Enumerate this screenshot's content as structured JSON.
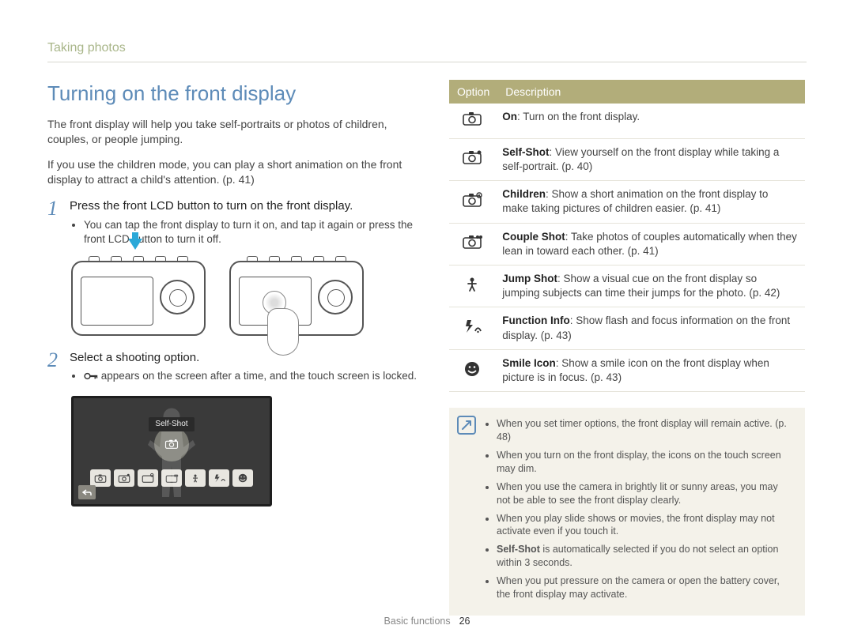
{
  "breadcrumb": "Taking photos",
  "title": "Turning on the front display",
  "intro1": "The front display will help you take self-portraits or photos of children, couples, or people jumping.",
  "intro2": "If you use the children mode, you can play a short animation on the front display to attract a child's attention. (p. 41)",
  "steps": [
    {
      "num": "1",
      "head": "Press the front LCD button to turn on the front display.",
      "bullets": [
        "You can tap the front display to turn it on, and tap it again or press the front LCD button to turn it off."
      ]
    },
    {
      "num": "2",
      "head": "Select a shooting option.",
      "bullets": [
        " appears on the screen after a time, and the touch screen is locked."
      ]
    }
  ],
  "lcd_label": "Self-Shot",
  "table": {
    "head_option": "Option",
    "head_desc": "Description",
    "rows": [
      {
        "bold": "On",
        "text": ": Turn on the front display."
      },
      {
        "bold": "Self-Shot",
        "text": ": View yourself on the front display while taking a self-portrait. (p. 40)"
      },
      {
        "bold": "Children",
        "text": ": Show a short animation on the front display to make taking pictures of children easier. (p. 41)"
      },
      {
        "bold": "Couple Shot",
        "text": ": Take photos of couples automatically when they lean in toward each other. (p. 41)"
      },
      {
        "bold": "Jump Shot",
        "text": ": Show a visual cue on the front display so jumping subjects can time their jumps for the photo. (p. 42)"
      },
      {
        "bold": "Function Info",
        "text": ": Show flash and focus information on the front display. (p. 43)"
      },
      {
        "bold": "Smile Icon",
        "text": ": Show a smile icon on the front display when picture is in focus. (p. 43)"
      }
    ]
  },
  "notes": [
    "When you set timer options, the front display will remain active. (p. 48)",
    "When you turn on the front display, the icons on the touch screen may dim.",
    "When you use the camera in brightly lit or sunny areas, you may not be able to see the front display clearly.",
    "When you play slide shows or movies, the front display may not activate even if you touch it.",
    "Self-Shot is automatically selected if you do not select an option within 3 seconds.",
    "When you put pressure on the camera or open the battery cover, the front display may activate."
  ],
  "note_bold_idx": 4,
  "note_bold_word": "Self-Shot",
  "footer_section": "Basic functions",
  "footer_page": "26"
}
